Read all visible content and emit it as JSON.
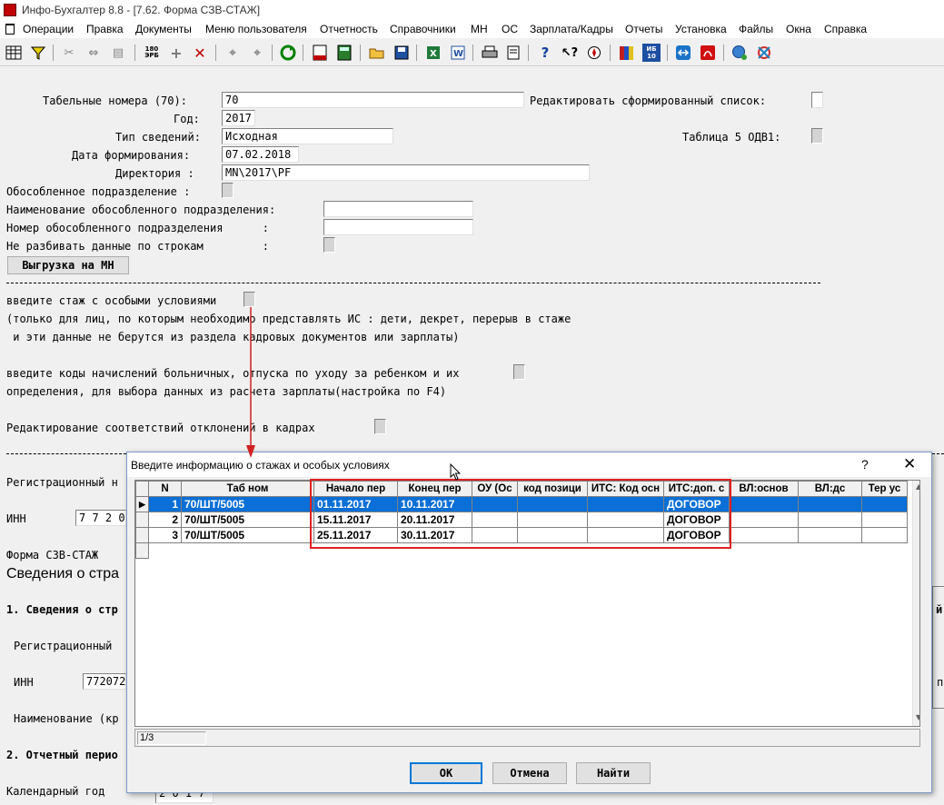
{
  "window": {
    "title": "Инфо-Бухгалтер 8.8 - [7.62. Форма СЗВ-СТАЖ]"
  },
  "menu": [
    "Операции",
    "Правка",
    "Документы",
    "Меню пользователя",
    "Отчетность",
    "Справочники",
    "МН",
    "ОС",
    "Зарплата/Кадры",
    "Отчеты",
    "Установка",
    "Файлы",
    "Окна",
    "Справка"
  ],
  "toolbar": {
    "icons": [
      "calculator-grid-icon",
      "filter-icon",
      "cut-icon",
      "move-icon",
      "paste-icon",
      "number-180-icon",
      "add-icon",
      "delete-icon",
      "tool1-icon",
      "tool2-icon",
      "refresh-icon",
      "report-icon",
      "calculator-icon",
      "open-folder-icon",
      "save-icon",
      "excel-icon",
      "word-icon",
      "print-icon",
      "preview-icon",
      "help-icon",
      "context-help-icon",
      "compass-icon",
      "books-icon",
      "ib10-icon",
      "teamviewer-icon",
      "acrobat-icon",
      "web-icon",
      "network-icon"
    ],
    "num_180": "180\nЭРБ",
    "ib_label": "ИБ\n10"
  },
  "form": {
    "tab_nums_label": "Табельные номера (70):",
    "tab_nums_value": "70",
    "edit_list_label": "Редактировать сформированный список:",
    "year_label": "Год:",
    "year_value": "2017",
    "type_label": "Тип сведений:",
    "type_value": "Исходная",
    "table5_label": "Таблица 5 ОДВ1:",
    "date_label": "Дата формирования:",
    "date_value": "07.02.2018",
    "dir_label": "Директория :",
    "dir_value": "MN\\2017\\PF",
    "separate_label": "Обособленное подразделение :",
    "sep_name_label": "Наименование обособленного подразделения:",
    "sep_num_label": "Номер обособленного подразделения      :",
    "no_split_label": "Не разбивать данные по строкам         :",
    "export_button": "Выгрузка на МН",
    "special_label": "введите стаж с особыми условиями",
    "special_note1": "(только для лиц, по которым необходимо представлять ИС : дети, декрет, перерыв в стаже",
    "special_note2": " и эти данные не берутся из раздела кадровых документов или зарплаты)",
    "codes_label1": "введите коды начислений больничных, отпуска по уходу за ребенком и их",
    "codes_label2": "определения, для выбора данных из расчета зарплаты(настройка по F4)",
    "dev_label": "Редактирование соответствий отклонений в кадрах",
    "reg_label": "Регистрационный н",
    "inn_label": "ИНН",
    "inn_partial": "7 7 2 0",
    "form_label": "Форма СЗВ-СТАЖ",
    "heading": "Сведения о стра",
    "section1": "1. Сведения о стр",
    "section1_right": "й",
    "reg2_label": "Регистрационный",
    "inn2_label": "ИНН",
    "inn2_value": "772072",
    "inn2_right": "п",
    "name_label": "Наименование (кр",
    "section2": "2. Отчетный перио",
    "calyear_label": "Календарный год",
    "calyear_value": "2 0 1 7"
  },
  "dialog": {
    "title": "Введите информацию о стажах и особых условиях",
    "help": "?",
    "close": "✕",
    "columns": [
      "N",
      "Таб ном",
      "Начало пер",
      "Конец пер",
      "ОУ (Ос",
      "код позици",
      "ИТС: Код осн",
      "ИТС:доп. с",
      "ВЛ:основ",
      "ВЛ:дс",
      "Тер ус"
    ],
    "rows": [
      {
        "n": "1",
        "tab": "70/ШТ/5005",
        "start": "01.11.2017",
        "end": "10.11.2017",
        "ou": "",
        "pos": "",
        "its_code": "",
        "its_add": "ДОГОВОР",
        "vl_main": "",
        "vl_ds": "",
        "ter": ""
      },
      {
        "n": "2",
        "tab": "70/ШТ/5005",
        "start": "15.11.2017",
        "end": "20.11.2017",
        "ou": "",
        "pos": "",
        "its_code": "",
        "its_add": "ДОГОВОР",
        "vl_main": "",
        "vl_ds": "",
        "ter": ""
      },
      {
        "n": "3",
        "tab": "70/ШТ/5005",
        "start": "25.11.2017",
        "end": "30.11.2017",
        "ou": "",
        "pos": "",
        "its_code": "",
        "its_add": "ДОГОВОР",
        "vl_main": "",
        "vl_ds": "",
        "ter": ""
      }
    ],
    "status": "1/3",
    "ok": "ОК",
    "cancel": "Отмена",
    "find": "Найти"
  },
  "colors": {
    "selection": "#0a6fd6",
    "highlight_box": "#e02020",
    "arrow": "#d02020"
  }
}
